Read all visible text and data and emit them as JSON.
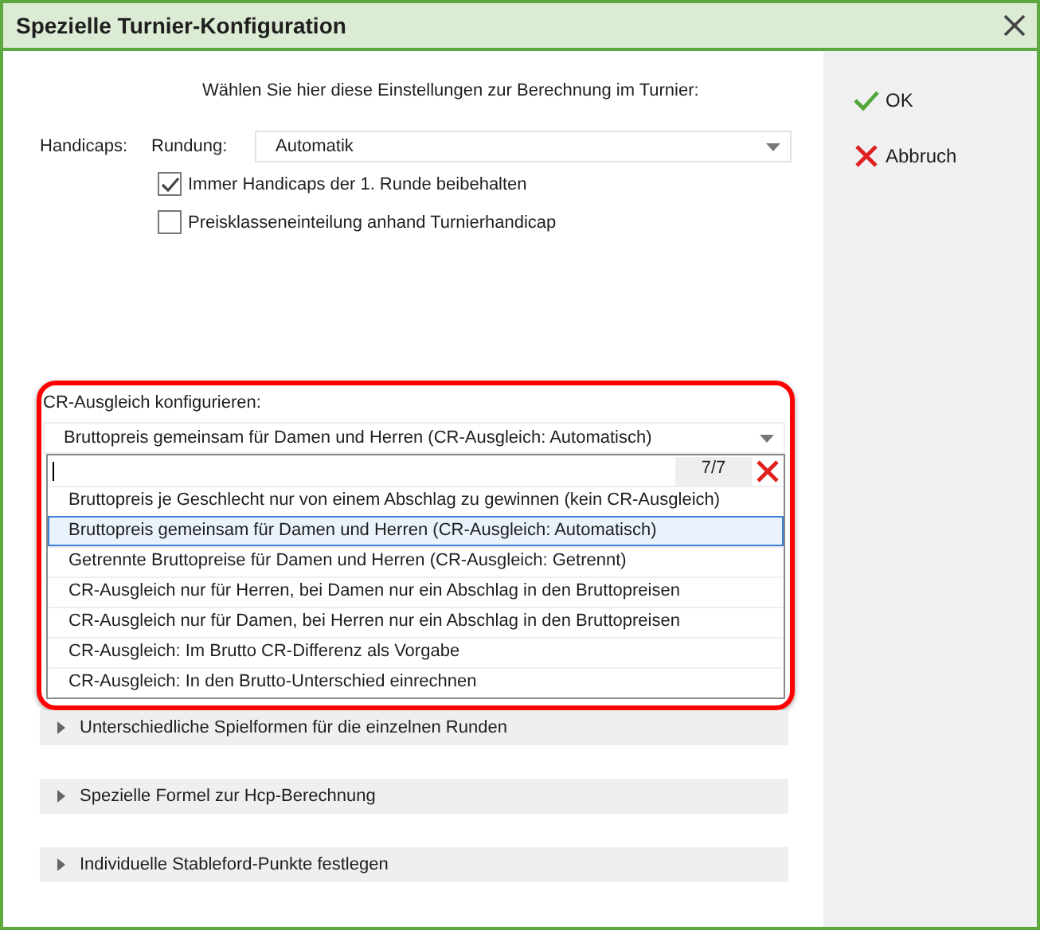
{
  "window": {
    "title": "Spezielle Turnier-Konfiguration"
  },
  "intro": "Wählen Sie hier diese Einstellungen zur Berechnung im Turnier:",
  "handicaps": {
    "label": "Handicaps:",
    "rounding_label": "Rundung:",
    "rounding_value": "Automatik"
  },
  "checkboxes": [
    {
      "label": "Immer Handicaps der 1. Runde beibehalten",
      "checked": true
    },
    {
      "label": "Preisklasseneinteilung anhand Turnierhandicap",
      "checked": false
    }
  ],
  "cr": {
    "label": "CR-Ausgleich konfigurieren:",
    "value": "Bruttopreis gemeinsam für Damen und Herren (CR-Ausgleich: Automatisch)",
    "count": "7/7",
    "options": [
      {
        "label": "Bruttopreis je Geschlecht nur von einem Abschlag zu gewinnen (kein CR-Ausgleich)",
        "selected": false
      },
      {
        "label": "Bruttopreis gemeinsam für Damen und Herren (CR-Ausgleich: Automatisch)",
        "selected": true
      },
      {
        "label": "Getrennte Bruttopreise für Damen und Herren (CR-Ausgleich: Getrennt)",
        "selected": false
      },
      {
        "label": "CR-Ausgleich nur für Herren, bei Damen nur ein Abschlag in den Bruttopreisen",
        "selected": false
      },
      {
        "label": "CR-Ausgleich nur für Damen, bei Herren nur ein Abschlag in den Bruttopreisen",
        "selected": false
      },
      {
        "label": "CR-Ausgleich: Im Brutto CR-Differenz als Vorgabe",
        "selected": false
      },
      {
        "label": "CR-Ausgleich: In den Brutto-Unterschied einrechnen",
        "selected": false
      }
    ]
  },
  "sections": [
    {
      "label": "Unterschiedliche Spielformen für die einzelnen Runden",
      "expanded": false
    },
    {
      "label": "Spezielle Formel zur Hcp-Berechnung",
      "expanded": false
    },
    {
      "label": "Individuelle Stableford-Punkte festlegen",
      "expanded": false
    }
  ],
  "buttons": [
    {
      "kind": "ok",
      "label": "OK"
    },
    {
      "kind": "cancel",
      "label": "Abbruch"
    }
  ]
}
